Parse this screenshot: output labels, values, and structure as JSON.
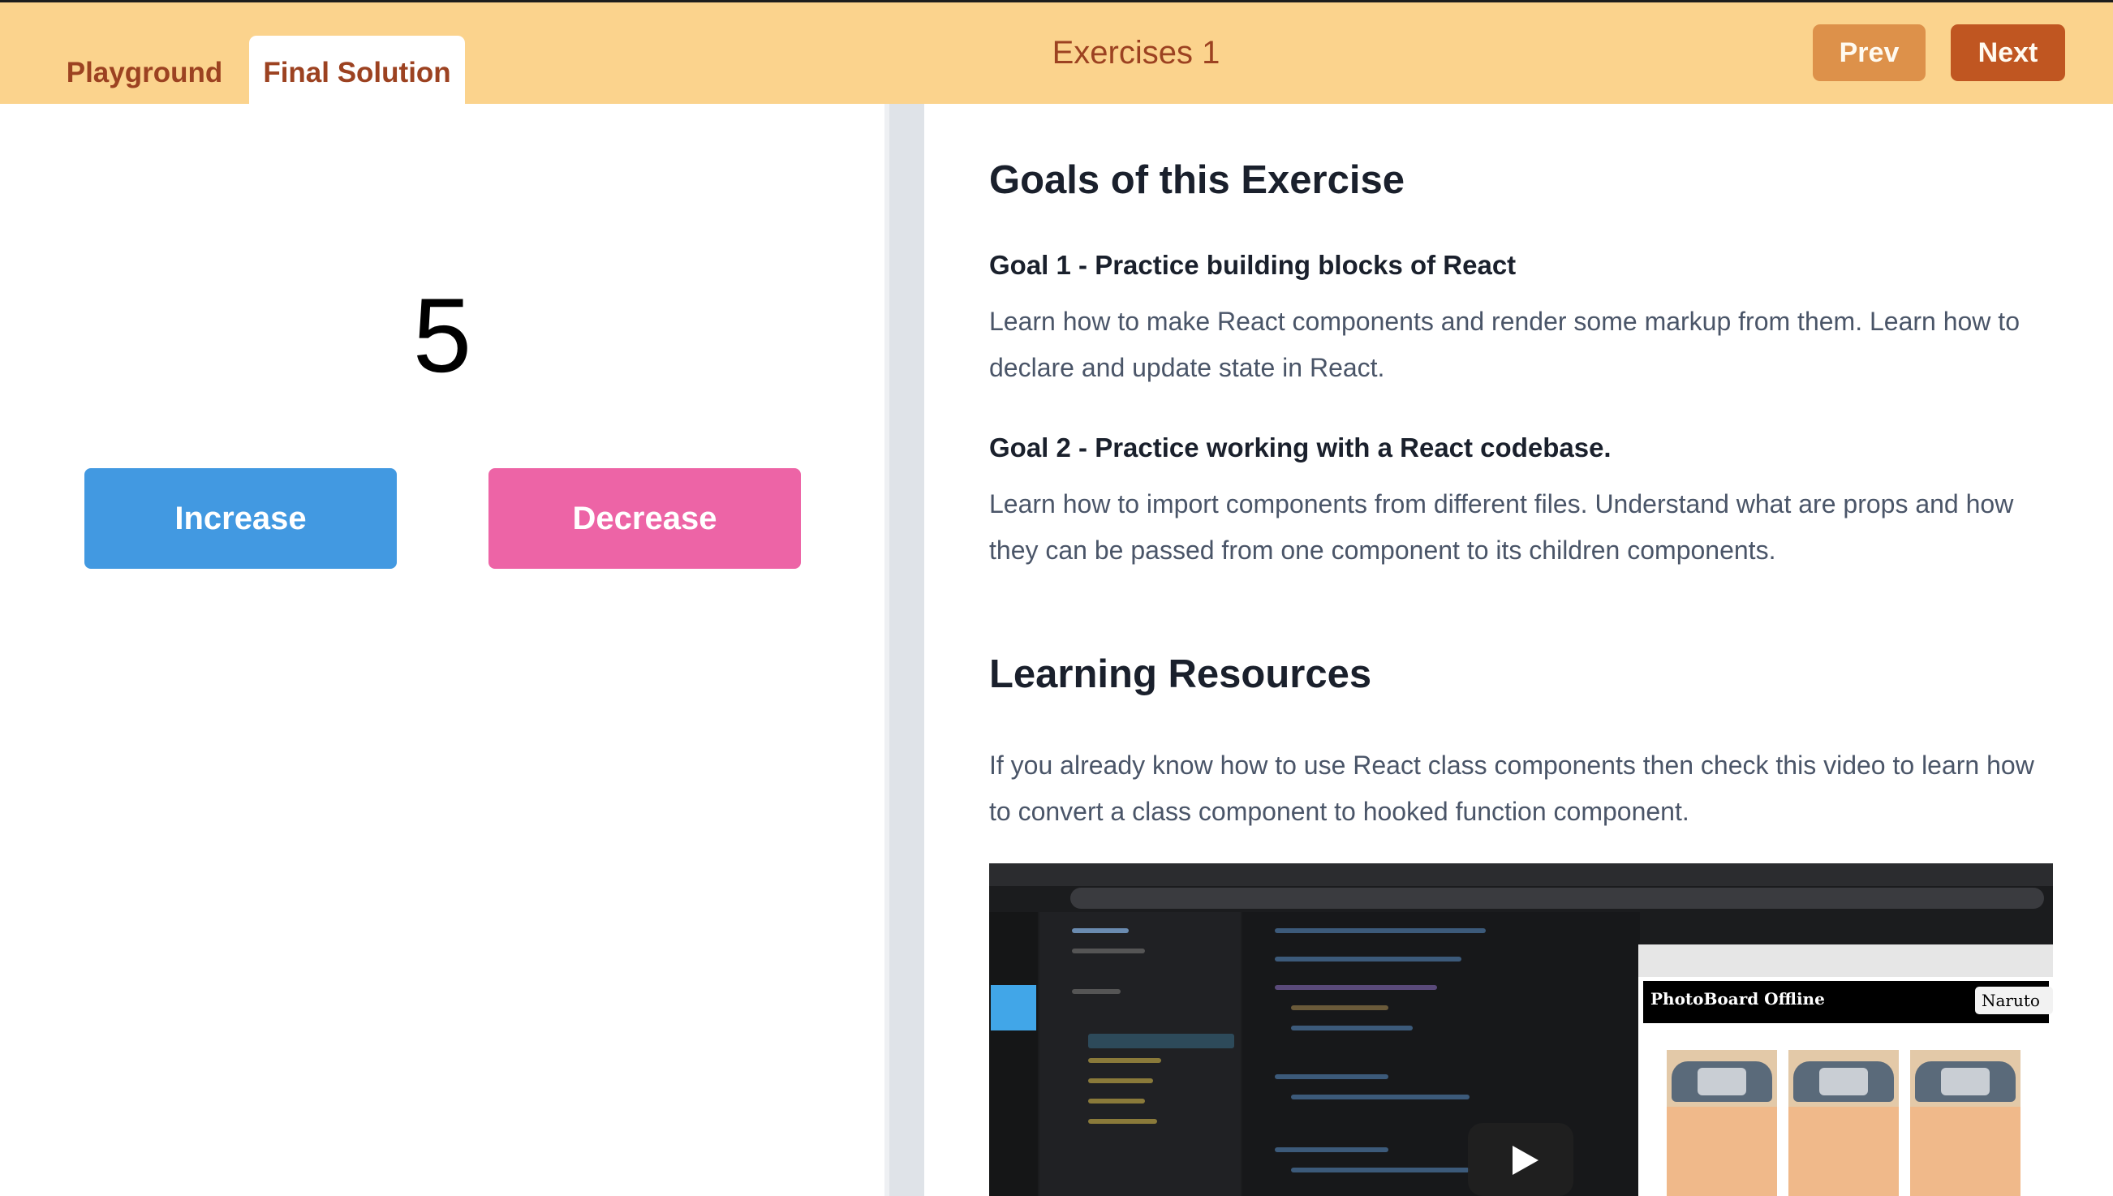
{
  "header": {
    "tabs": [
      {
        "label": "Playground",
        "active": false
      },
      {
        "label": "Final Solution",
        "active": true
      }
    ],
    "title": "Exercises 1",
    "prev_label": "Prev",
    "next_label": "Next"
  },
  "counter": {
    "value": "5",
    "increase_label": "Increase",
    "decrease_label": "Decrease"
  },
  "content": {
    "goals_heading": "Goals of this Exercise",
    "goal1_title": "Goal 1 - Practice building blocks of React",
    "goal1_text": "Learn how to make React components and render some markup from them. Learn how to declare and update state in React.",
    "goal2_title": "Goal 2 - Practice working with a React codebase.",
    "goal2_text": "Learn how to import components from different files. Understand what are props and how they can be passed from one component to its children components.",
    "resources_heading": "Learning Resources",
    "resources_text": "If you already know how to use React class components then check this video to learn how to convert a class component to hooked function component.",
    "video": {
      "preview_title": "PhotoBoard Offline",
      "preview_select": "Naruto",
      "play_icon": "play-icon"
    }
  },
  "colors": {
    "header_bg": "#fbd38d",
    "tab_text": "#9c4221",
    "prev_bg": "#dd914a",
    "next_bg": "#c05621",
    "increase_bg": "#4299e1",
    "decrease_bg": "#ed64a6"
  }
}
